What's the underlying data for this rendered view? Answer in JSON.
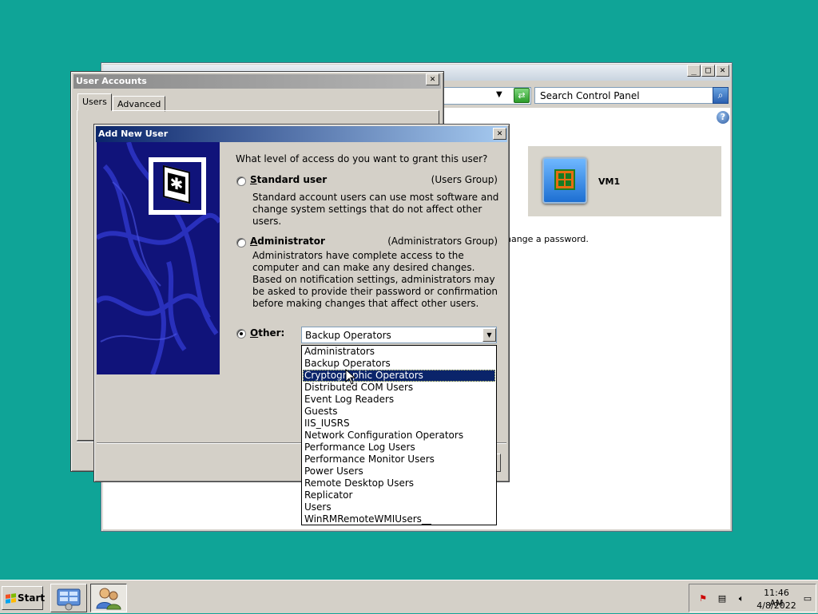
{
  "control_panel": {
    "search_placeholder": "Search Control Panel",
    "user_tile_name": "VM1",
    "change_password_text": "hange a password.",
    "min_label": "_",
    "max_label": "□",
    "close_label": "✕",
    "address_arrow": "▼",
    "go_arrow": "⇄",
    "search_glyph": "⌕",
    "help_glyph": "?"
  },
  "user_accounts": {
    "title": "User Accounts",
    "close_label": "✕",
    "tabs": [
      {
        "label": "Users"
      },
      {
        "label": "Advanced"
      }
    ]
  },
  "add_new_user": {
    "title": "Add New User",
    "close_label": "✕",
    "question": "What level of access do you want to grant this user?",
    "options": [
      {
        "label_underline": "S",
        "label_rest": "tandard user",
        "group": "(Users Group)",
        "description": "Standard account users can use most software and change system settings that do not affect other users.",
        "checked": false
      },
      {
        "label_underline": "A",
        "label_rest": "dministrator",
        "group": "(Administrators Group)",
        "description": "Administrators have complete access to the computer and can make any desired changes. Based on notification settings, administrators may be asked to provide their password or confirmation before making changes that affect other users.",
        "checked": false
      },
      {
        "label_underline": "O",
        "label_rest": "ther:",
        "checked": true
      }
    ],
    "other_selected": "Backup Operators",
    "combo_arrow": "▼"
  },
  "dropdown": {
    "items": [
      "Administrators",
      "Backup Operators",
      "Cryptographic Operators",
      "Distributed COM Users",
      "Event Log Readers",
      "Guests",
      "IIS_IUSRS",
      "Network Configuration Operators",
      "Performance Log Users",
      "Performance Monitor Users",
      "Power Users",
      "Remote Desktop Users",
      "Replicator",
      "Users",
      "WinRMRemoteWMIUsers__"
    ],
    "highlighted_index": 2
  },
  "taskbar": {
    "start_label": "Start",
    "clock_time": "11:46 AM",
    "clock_date": "4/8/2022"
  },
  "colors": {
    "desktop": "#0fa497",
    "title_active": "#0a246a",
    "selection": "#0a246a",
    "banner": "#10137a"
  }
}
